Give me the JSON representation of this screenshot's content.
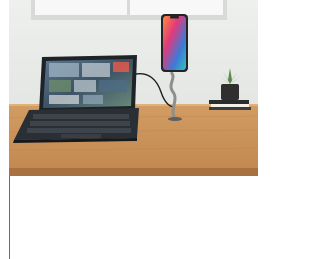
{
  "image": {
    "subject": "product-photo",
    "objects": [
      "tablet-with-keyboard",
      "smartphone-on-flexible-stand",
      "potted-succulent",
      "book-stack",
      "charging-cable"
    ],
    "colors": {
      "wall": "#e9ecea",
      "desk": "#c8935b",
      "desk_edge": "#a8713f",
      "window_frame": "#d7dad6",
      "tablet_body": "#1e2328",
      "keyboard": "#2a2f35",
      "stand_metal": "#8e8f8c",
      "plant_green": "#5c8a4a",
      "pot": "#2f2f2f"
    }
  }
}
